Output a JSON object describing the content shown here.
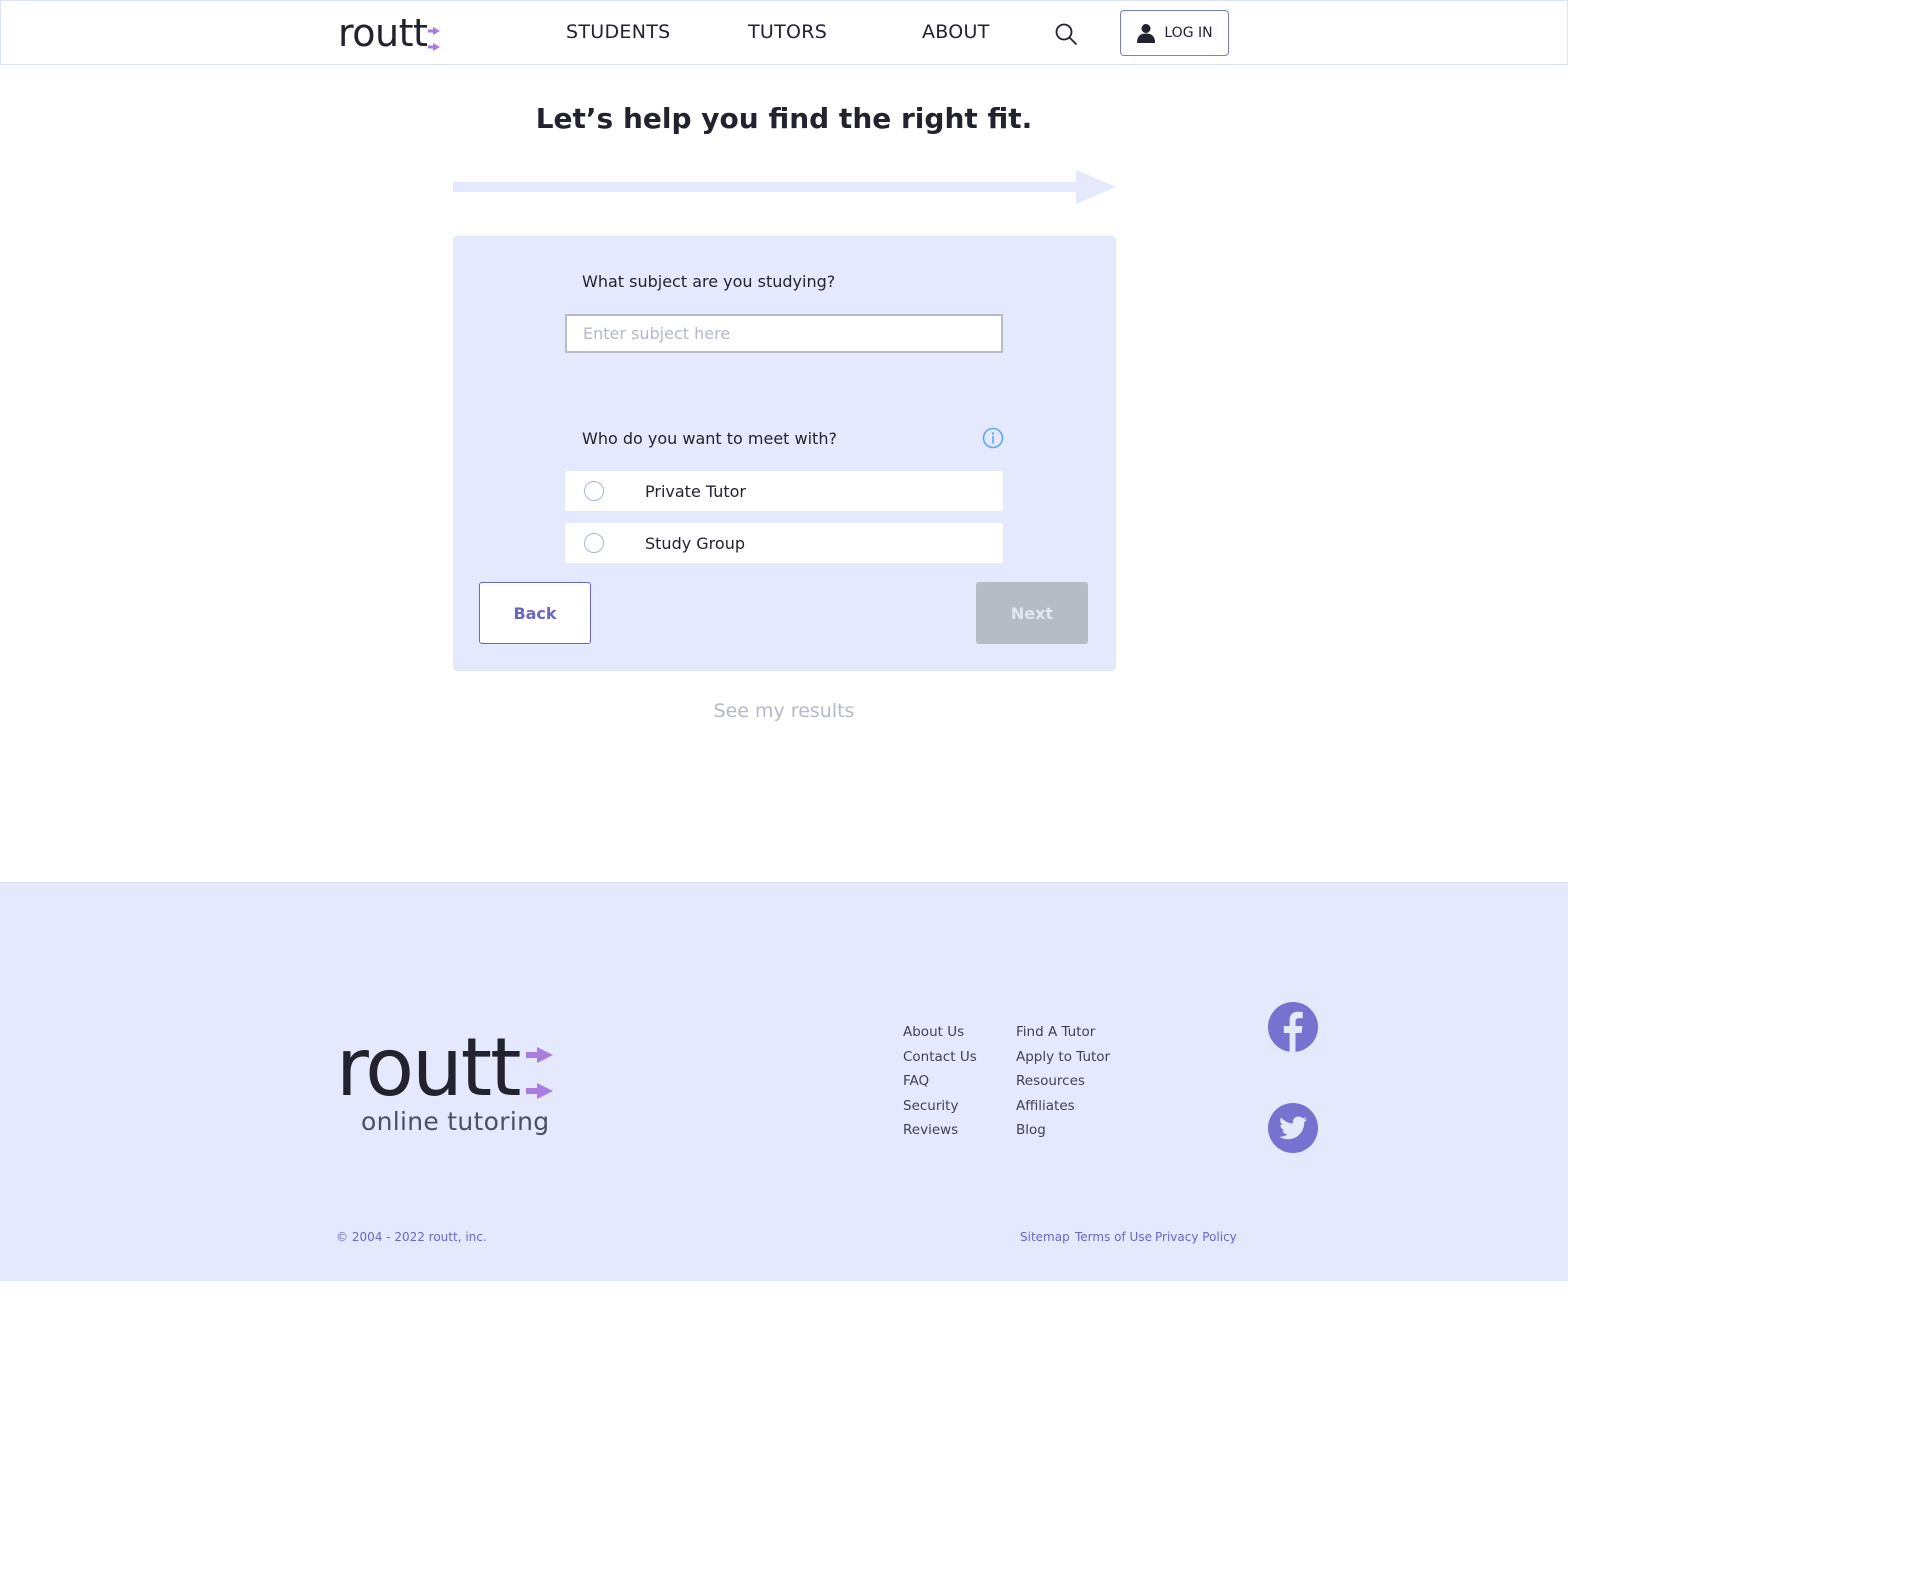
{
  "header": {
    "logo_text": "routt",
    "nav": {
      "students": "STUDENTS",
      "tutors": "TUTORS",
      "about": "ABOUT"
    },
    "login_label": "LOG IN"
  },
  "main": {
    "title": "Let’s help you find the right fit.",
    "question_subject": "What subject are you studying?",
    "subject_placeholder": "Enter subject here",
    "subject_value": "",
    "question_meet": "Who do you want to meet with?",
    "options": [
      {
        "label": "Private Tutor",
        "selected": false
      },
      {
        "label": "Study Group",
        "selected": false
      }
    ],
    "back_label": "Back",
    "next_label": "Next",
    "see_results": "See my results"
  },
  "footer": {
    "logo_text": "routt",
    "tagline": "online tutoring",
    "col1": [
      "About Us",
      "Contact Us",
      "FAQ",
      "Security",
      "Reviews"
    ],
    "col2": [
      "Find A Tutor",
      "Apply to Tutor",
      "Resources",
      "Affiliates",
      "Blog"
    ],
    "copyright": "© 2004 - 2022 routt, inc.",
    "legal": {
      "sitemap": "Sitemap",
      "terms": "Terms of Use",
      "privacy": "Privacy Policy"
    }
  },
  "colors": {
    "accent": "#6a66c9",
    "card_bg": "#e5e9fd",
    "logo_arrow": "#a97ddf",
    "social_bg": "#7672cf",
    "info_icon": "#5aa8f0",
    "disabled_button": "#b5bcc6"
  },
  "icons": {
    "search": "search-icon",
    "user": "user-icon",
    "info": "info-icon",
    "facebook": "facebook-icon",
    "twitter": "twitter-icon"
  }
}
